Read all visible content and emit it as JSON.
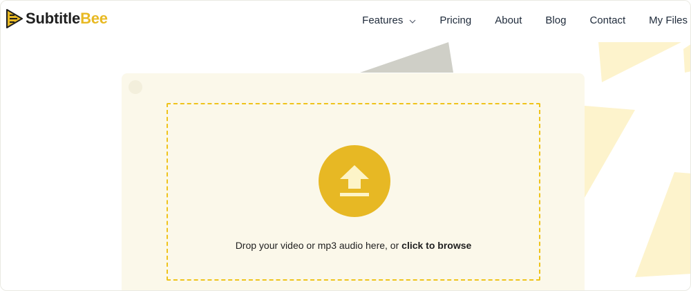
{
  "brand": {
    "name_part1": "Subtitle",
    "name_part2": "Bee",
    "logo_icon": "play-bee-icon",
    "colors": {
      "primary": "#e8b923",
      "dark": "#1f1f1f"
    }
  },
  "nav": {
    "items": [
      {
        "label": "Features",
        "has_dropdown": true
      },
      {
        "label": "Pricing"
      },
      {
        "label": "About"
      },
      {
        "label": "Blog"
      },
      {
        "label": "Contact"
      },
      {
        "label": "My Files"
      }
    ]
  },
  "upload": {
    "icon": "upload-arrow-icon",
    "prompt": "Drop your video or mp3 audio here, or ",
    "browse_label": "click to browse",
    "colors": {
      "accent": "#e7b824",
      "card_bg": "#fbf8ea",
      "dash": "#efc31a"
    }
  }
}
